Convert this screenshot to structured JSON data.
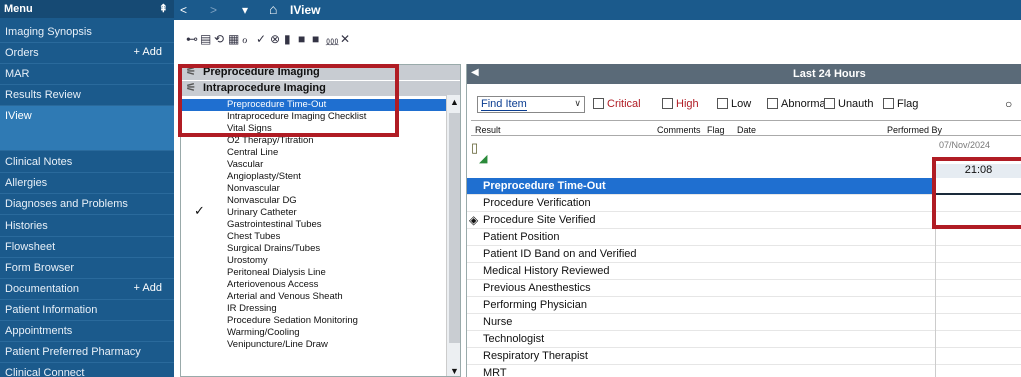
{
  "sidebar": {
    "header": "Menu",
    "pin": "⇞",
    "items": [
      {
        "label": "Imaging Synopsis"
      },
      {
        "label": "Orders",
        "add": "+ Add"
      },
      {
        "label": "MAR"
      },
      {
        "label": "Results Review"
      },
      {
        "label": "IView",
        "active": true
      },
      {
        "label": "Clinical Notes"
      },
      {
        "label": "Allergies"
      },
      {
        "label": "Diagnoses and Problems"
      },
      {
        "label": "Histories"
      },
      {
        "label": "Flowsheet"
      },
      {
        "label": "Form Browser"
      },
      {
        "label": "Documentation",
        "add": "+ Add"
      },
      {
        "label": "Patient Information"
      },
      {
        "label": "Appointments"
      },
      {
        "label": "Patient Preferred Pharmacy"
      },
      {
        "label": "Clinical Connect"
      }
    ]
  },
  "topbar": {
    "back": "<",
    "forward": ">",
    "dropdown": "▾",
    "home": "⌂",
    "title": "IView"
  },
  "toolbar_icons": [
    "⊷",
    "▤",
    "⟲",
    "▦",
    "ℴ",
    "✓",
    "⊗",
    "▮",
    "■",
    "■",
    "⅏",
    "✕"
  ],
  "navigator": {
    "band1": "Preprocedure Imaging",
    "band2": "Intraprocedure Imaging",
    "sections": [
      {
        "label": "Preprocedure Time-Out",
        "selected": true
      },
      {
        "label": "Intraprocedure Imaging Checklist"
      },
      {
        "label": "Vital Signs"
      },
      {
        "label": "O2 Therapy/Titration"
      },
      {
        "label": "Central Line"
      },
      {
        "label": "Vascular"
      },
      {
        "label": "Angioplasty/Stent"
      },
      {
        "label": "Nonvascular",
        "checked": true
      },
      {
        "label": "Nonvascular DG"
      },
      {
        "label": "Urinary Catheter"
      },
      {
        "label": "Gastrointestinal Tubes"
      },
      {
        "label": "Chest Tubes"
      },
      {
        "label": "Surgical Drains/Tubes"
      },
      {
        "label": "Urostomy"
      },
      {
        "label": "Peritoneal Dialysis Line"
      },
      {
        "label": "Arteriovenous Access"
      },
      {
        "label": "Arterial and Venous Sheath"
      },
      {
        "label": "IR Dressing"
      },
      {
        "label": "Procedure Sedation Monitoring"
      },
      {
        "label": "Warming/Cooling"
      },
      {
        "label": "Venipuncture/Line Draw"
      }
    ],
    "check_glyph": "✓"
  },
  "right_panel": {
    "header": "Last 24 Hours",
    "find_label": "Find Item",
    "filters": [
      "Critical",
      "High",
      "Low",
      "Abnormal",
      "Unauth",
      "Flag"
    ],
    "columns": [
      "Result",
      "Comments",
      "Flag",
      "Date",
      "Performed By"
    ],
    "date_label": "07/Nov/2024",
    "time_label": "21:08",
    "rows": [
      {
        "label": "Preprocedure Time-Out",
        "selected": true
      },
      {
        "label": "Procedure Verification"
      },
      {
        "label": "Procedure Site Verified",
        "icon": "◈"
      },
      {
        "label": "Patient Position"
      },
      {
        "label": "Patient ID Band on and Verified"
      },
      {
        "label": "Medical History Reviewed"
      },
      {
        "label": "Previous Anesthestics"
      },
      {
        "label": "Performing Physician"
      },
      {
        "label": "Nurse"
      },
      {
        "label": "Technologist"
      },
      {
        "label": "Respiratory Therapist"
      },
      {
        "label": "MRT"
      }
    ]
  },
  "colors": {
    "sidebar": "#1b5a8c",
    "selection": "#1f6fd0",
    "annotation": "#b01c24"
  }
}
